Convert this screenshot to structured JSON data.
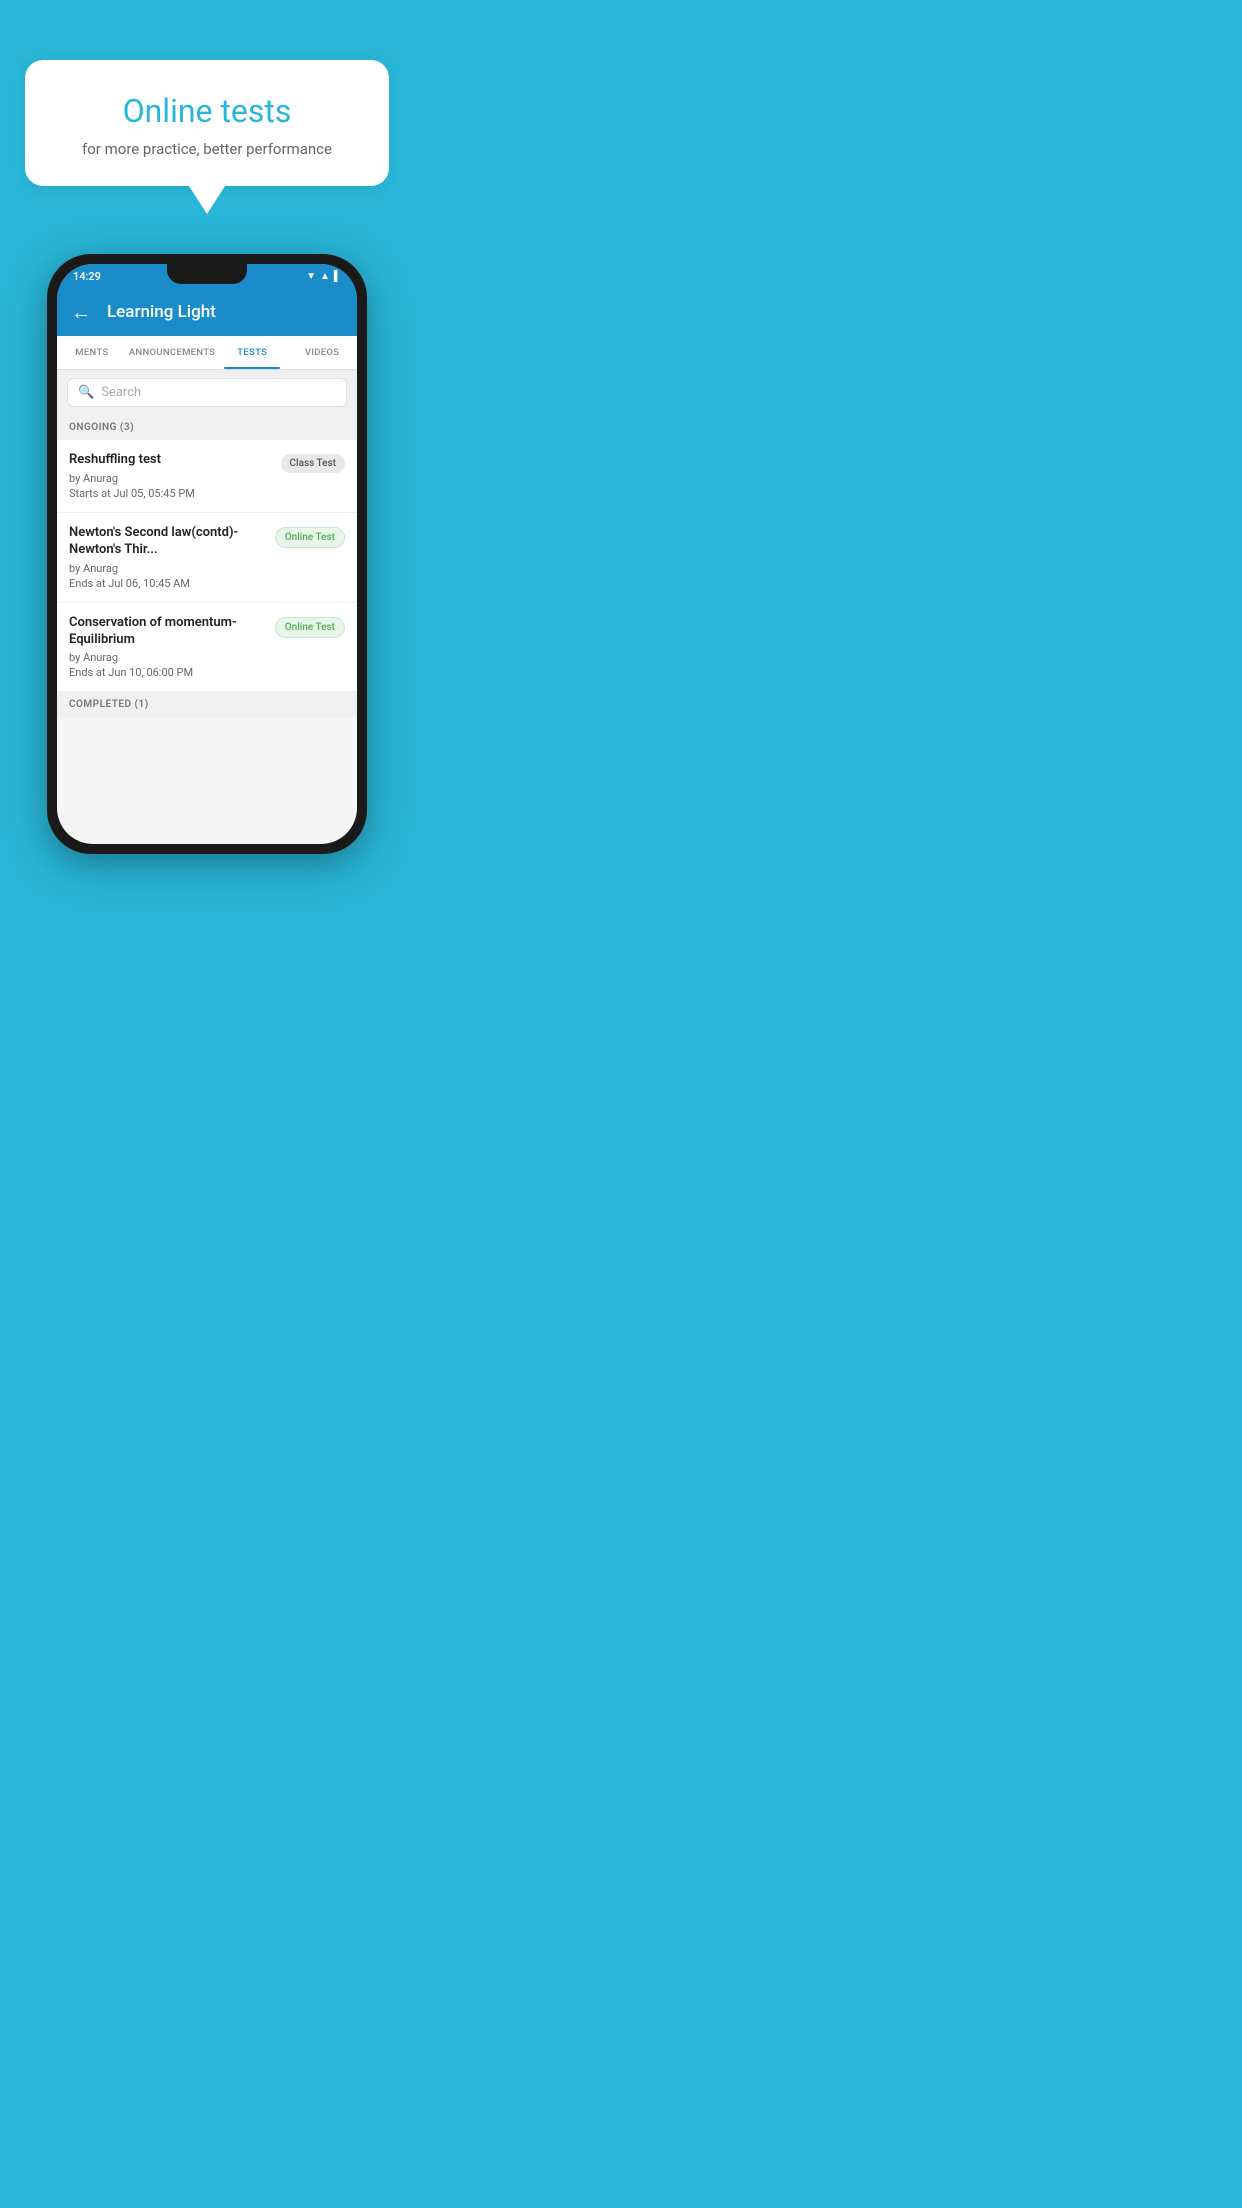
{
  "background_color": "#29B6D8",
  "speech_bubble": {
    "title": "Online tests",
    "subtitle": "for more practice, better performance"
  },
  "phone": {
    "status_bar": {
      "time": "14:29",
      "icons": [
        "▼",
        "▲",
        "▌"
      ]
    },
    "header": {
      "back_label": "←",
      "title": "Learning Light"
    },
    "tabs": [
      {
        "label": "MENTS",
        "active": false
      },
      {
        "label": "ANNOUNCEMENTS",
        "active": false
      },
      {
        "label": "TESTS",
        "active": true
      },
      {
        "label": "VIDEOS",
        "active": false
      }
    ],
    "search": {
      "placeholder": "Search"
    },
    "sections": [
      {
        "header": "ONGOING (3)",
        "tests": [
          {
            "title": "Reshuffling test",
            "author": "by Anurag",
            "date": "Starts at  Jul 05, 05:45 PM",
            "badge": "Class Test",
            "badge_type": "class"
          },
          {
            "title": "Newton's Second law(contd)-Newton's Thir...",
            "author": "by Anurag",
            "date": "Ends at  Jul 06, 10:45 AM",
            "badge": "Online Test",
            "badge_type": "online"
          },
          {
            "title": "Conservation of momentum-Equilibrium",
            "author": "by Anurag",
            "date": "Ends at  Jun 10, 06:00 PM",
            "badge": "Online Test",
            "badge_type": "online"
          }
        ]
      }
    ],
    "completed_section": {
      "header": "COMPLETED (1)"
    }
  }
}
